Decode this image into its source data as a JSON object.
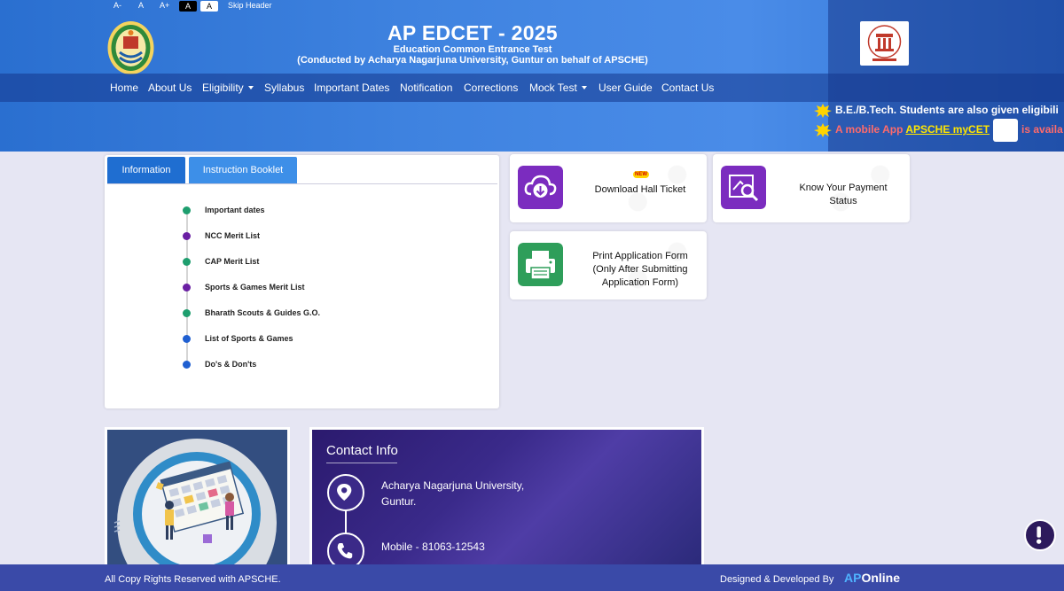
{
  "accessibility": {
    "decrease": "A-",
    "normal": "A",
    "increase": "A+",
    "dark_theme": "A",
    "light_theme": "A",
    "skip": "Skip Header"
  },
  "header": {
    "title": "AP EDCET - 2025",
    "subtitle": "Education Common Entrance Test",
    "subtitle2": "(Conducted by Acharya Nagarjuna University, Guntur on behalf of APSCHE)"
  },
  "nav": {
    "home": "Home",
    "about": "About Us",
    "eligibility": "Eligibility",
    "syllabus": "Syllabus",
    "dates": "Important Dates",
    "notification": "Notification",
    "corrections": "Corrections",
    "mock": "Mock Test",
    "guide": "User Guide",
    "contact": "Contact Us"
  },
  "marquee": {
    "line1": "B.E./B.Tech. Students are also given eligibili",
    "line2_pre": "A mobile App",
    "line2_link": "APSCHE myCET",
    "line2_post": "is availa"
  },
  "tabs": {
    "active": "Information",
    "inactive": "Instruction Booklet"
  },
  "info_items": [
    {
      "label": "Important dates",
      "color": "#1e9e6e"
    },
    {
      "label": "NCC Merit List",
      "color": "#6a1fa3"
    },
    {
      "label": "CAP Merit List",
      "color": "#1e9e6e"
    },
    {
      "label": "Sports & Games Merit List",
      "color": "#6a1fa3"
    },
    {
      "label": "Bharath Scouts & Guides G.O.",
      "color": "#1e9e6e"
    },
    {
      "label": "List of Sports & Games",
      "color": "#1f5fd1"
    },
    {
      "label": "Do's & Don'ts",
      "color": "#1f5fd1"
    }
  ],
  "cards": {
    "hall_ticket": "Download Hall Ticket",
    "new_badge": "NEW",
    "payment_line1": "Know Your Payment",
    "payment_line2": "Status",
    "print_line1": "Print Application Form",
    "print_line2": "(Only After Submitting",
    "print_line3": "Application Form)"
  },
  "contact": {
    "title": "Contact Info",
    "address_line1": "Acharya Nagarjuna University,",
    "address_line2": "Guntur.",
    "mobile": "Mobile - 81063-12543"
  },
  "footer": {
    "copyright": "All Copy Rights Reserved with APSCHE.",
    "designed": "Designed & Developed By",
    "brand_ap": "AP",
    "brand_online": "Online"
  },
  "colors": {
    "header_blue": "#3f83e0",
    "tab_active": "#1f6ed1",
    "tab_inactive": "#3d8fe8",
    "icon_purple": "#7b2cbf",
    "icon_green": "#2e9e5a",
    "footer": "#3a4aa8",
    "contact_bg": "#3a2a8a"
  }
}
